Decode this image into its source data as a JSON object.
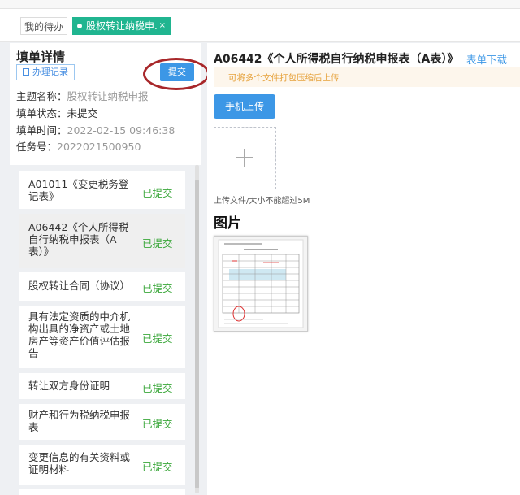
{
  "tabs": [
    {
      "label": "我的待办"
    },
    {
      "label": "股权转让纳税申...",
      "close": "×"
    }
  ],
  "left": {
    "title": "填单详情",
    "record_button": "办理记录",
    "submit_button": "提交",
    "fields": [
      {
        "label": "主题名称：",
        "value": "股权转让纳税申报"
      },
      {
        "label": "填单状态：",
        "value": "未提交"
      },
      {
        "label": "填单时间：",
        "value": "2022-02-15 09:46:38"
      },
      {
        "label": "任务号：",
        "value": "2022021500950"
      }
    ],
    "documents": [
      {
        "name": "A01011《变更税务登记表》",
        "status": "已提交"
      },
      {
        "name": "A06442《个人所得税自行纳税申报表（A表）》",
        "status": "已提交"
      },
      {
        "name": "股权转让合同（协议）",
        "status": "已提交"
      },
      {
        "name": "具有法定资质的中介机构出具的净资产或土地房产等资产价值评估报告",
        "status": "已提交"
      },
      {
        "name": "转让双方身份证明",
        "status": "已提交"
      },
      {
        "name": "财产和行为税纳税申报表",
        "status": "已提交"
      },
      {
        "name": "变更信息的有关资料或证明材料",
        "status": "已提交"
      }
    ],
    "selected_index": 1
  },
  "right": {
    "form_title": "A06442《个人所得税自行纳税申报表（A表）》",
    "download_link": "表单下载",
    "hint": "可将多个文件打包压缩后上传",
    "mobile_upload_button": "手机上传",
    "upload_hint": "上传文件/大小不能超过5M",
    "images_heading": "图片"
  },
  "colors": {
    "accent_green": "#20b590",
    "primary_blue": "#3c97e6",
    "status_green": "#3aa73a",
    "annotation_red": "#a8272a",
    "warning_orange": "#e6a23c"
  }
}
